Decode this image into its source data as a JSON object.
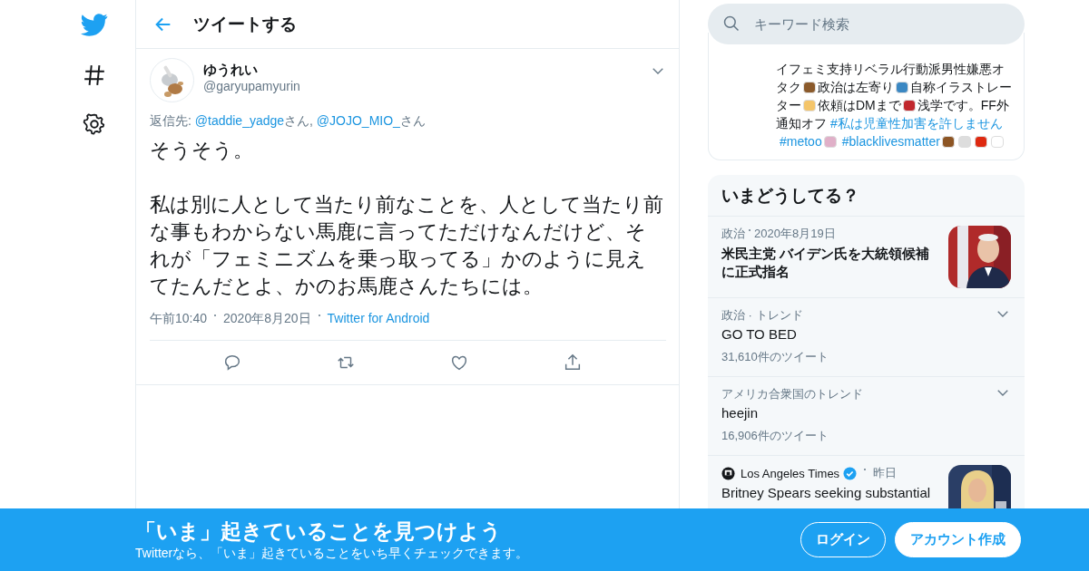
{
  "nav": {
    "items": [
      {
        "kind": "bird"
      },
      {
        "kind": "hash"
      },
      {
        "kind": "gear"
      }
    ]
  },
  "header": {
    "title": "ツイートする"
  },
  "tweet": {
    "name": "ゆうれい",
    "handle": "@garyupamyurin",
    "reply": [
      {
        "kind": "label",
        "text": "返信先: "
      },
      {
        "kind": "link",
        "text": "@taddie_yadge"
      },
      {
        "kind": "label",
        "text": "さん, "
      },
      {
        "kind": "link",
        "text": "@JOJO_MIO_"
      },
      {
        "kind": "label",
        "text": "さん"
      }
    ],
    "paragraphs": [
      "そうそう。",
      "私は別に人として当たり前なことを、人として当たり前な事もわからない馬鹿に言ってただけなんだけど、それが「フェミニズムを乗っ取ってる」かのように見えてたんだとよ、かのお馬鹿さんたちには。"
    ],
    "time": "午前10:40",
    "date": "2020年8月20日",
    "source": "Twitter for Android",
    "actions": [
      {
        "kind": "reply"
      },
      {
        "kind": "retweet"
      },
      {
        "kind": "like"
      },
      {
        "kind": "share"
      }
    ]
  },
  "search": {
    "placeholder": "キーワード検索"
  },
  "bio": [
    {
      "kind": "text",
      "text": "イフェミ支持リベラル行動派男性嫌悪オタク"
    },
    {
      "kind": "emoji",
      "color": "#8b5a2b"
    },
    {
      "kind": "text",
      "text": "政治は左寄り"
    },
    {
      "kind": "emoji",
      "color": "#3b88c3"
    },
    {
      "kind": "text",
      "text": "自称イラストレーター"
    },
    {
      "kind": "emoji",
      "color": "#f4c56a"
    },
    {
      "kind": "text",
      "text": "依頼はDMまで"
    },
    {
      "kind": "emoji",
      "color": "#c1272d"
    },
    {
      "kind": "text",
      "text": "浅学です。FF外通知オフ "
    },
    {
      "kind": "tag",
      "text": "#私は児童性加害を許しません"
    },
    {
      "kind": "tag",
      "text": "#metoo"
    },
    {
      "kind": "emoji",
      "color": "#e0b0c8"
    },
    {
      "kind": "tag",
      "text": "#blacklivesmatter"
    },
    {
      "kind": "emoji",
      "color": "#8d5524"
    },
    {
      "kind": "emoji",
      "color": "#dddddd"
    },
    {
      "kind": "emoji",
      "color": "#de2910"
    },
    {
      "kind": "emoji",
      "color": "#ffffff"
    }
  ],
  "trends": {
    "title": "いまどうしてる？",
    "items": [
      {
        "kind": "news",
        "meta": "政治",
        "time": "2020年8月19日",
        "headline": "米民主党 バイデン氏を大統領候補に正式指名"
      },
      {
        "kind": "trend",
        "meta": "政治 · トレンド",
        "name": "GO TO BED",
        "count": "31,610件のツイート"
      },
      {
        "kind": "trend",
        "meta": "アメリカ合衆国のトレンド",
        "name": "heejin",
        "count": "16,906件のツイート"
      },
      {
        "kind": "source-news",
        "source": "Los Angeles Times",
        "verified": true,
        "time": "昨日",
        "headline": "Britney Spears seeking substantial"
      }
    ]
  },
  "banner": {
    "title": "「いま」起きていることを見つけよう",
    "subtitle": "Twitterなら、「いま」起きていることをいち早くチェックできます。",
    "buttons": [
      {
        "kind": "outline",
        "label": "ログイン"
      },
      {
        "kind": "filled",
        "label": "アカウント作成"
      }
    ]
  }
}
